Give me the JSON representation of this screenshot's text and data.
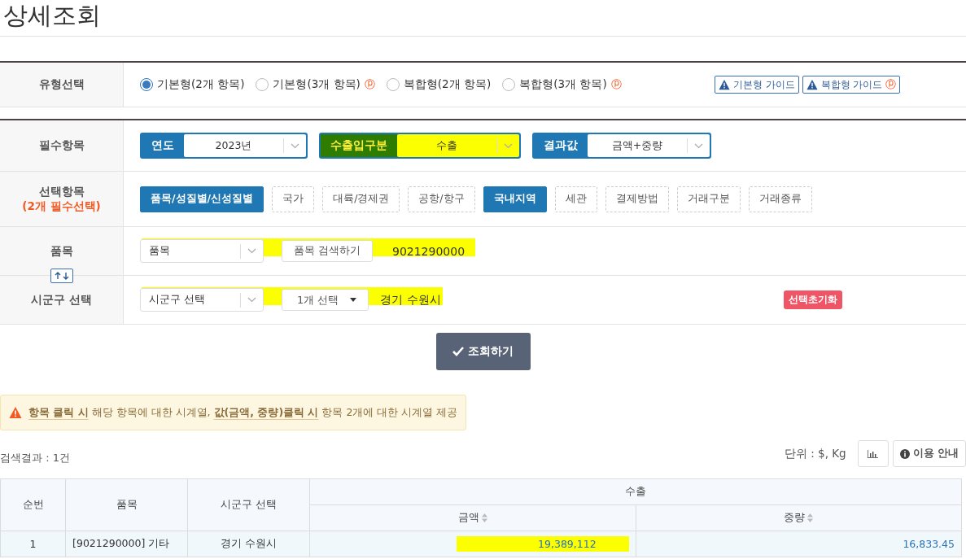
{
  "page_title": "상세조회",
  "type_row": {
    "label": "유형선택",
    "options": [
      {
        "label": "기본형(2개 항목)",
        "selected": true
      },
      {
        "label": "기본형(3개 항목)",
        "selected": false,
        "badge": "ⓟ"
      },
      {
        "label": "복합형(2개 항목)",
        "selected": false
      },
      {
        "label": "복합형(3개 항목)",
        "selected": false,
        "badge": "ⓟ"
      }
    ],
    "guides": [
      {
        "label": "기본형 가이드"
      },
      {
        "label": "복합형 가이드",
        "badge": "ⓟ"
      }
    ]
  },
  "required_row": {
    "label": "필수항목",
    "selects": [
      {
        "label": "연도",
        "value": "2023년",
        "highlighted": false
      },
      {
        "label": "수출입구분",
        "value": "수출",
        "highlighted": true
      },
      {
        "label": "결과값",
        "value": "금액+중량",
        "highlighted": false
      }
    ]
  },
  "choice_row": {
    "label": "선택항목",
    "note": "(2개 필수선택)",
    "chips": [
      {
        "label": "품목/성질별/신성질별",
        "selected": true
      },
      {
        "label": "국가",
        "selected": false
      },
      {
        "label": "대륙/경제권",
        "selected": false
      },
      {
        "label": "공항/항구",
        "selected": false
      },
      {
        "label": "국내지역",
        "selected": true
      },
      {
        "label": "세관",
        "selected": false
      },
      {
        "label": "결제방법",
        "selected": false
      },
      {
        "label": "거래구분",
        "selected": false
      },
      {
        "label": "거래종류",
        "selected": false
      }
    ]
  },
  "item_row": {
    "label": "품목",
    "select": "품목",
    "search_button": "품목 검색하기",
    "value": "9021290000",
    "highlighted": true
  },
  "region_row": {
    "label": "시군구 선택",
    "select": "시군구 선택",
    "dropdown": "1개 선택",
    "value": "경기 수원시",
    "highlighted": true,
    "reset_button": "선택초기화"
  },
  "search_button": "조회하기",
  "notice": "**항목 클릭 시** 해당 항목에 대한 시계열, **값(금액, 중량)클릭 시** 항목 2개에 대한 시계열 제공",
  "result_count": "검색결과 : 1건",
  "unit": "단위 : $, Kg",
  "guide_button": "이용 안내",
  "table": {
    "columns": [
      "순번",
      "품목",
      "시군구 선택"
    ],
    "group": "수출",
    "subcolumns": [
      "금액",
      "중량"
    ],
    "rows": [
      {
        "cells": [
          "1",
          "[9021290000] 기타",
          "경기 수원시"
        ],
        "values": [
          "19,389,112",
          "16,833.45"
        ],
        "highlighted": [
          true,
          false
        ]
      }
    ]
  }
}
